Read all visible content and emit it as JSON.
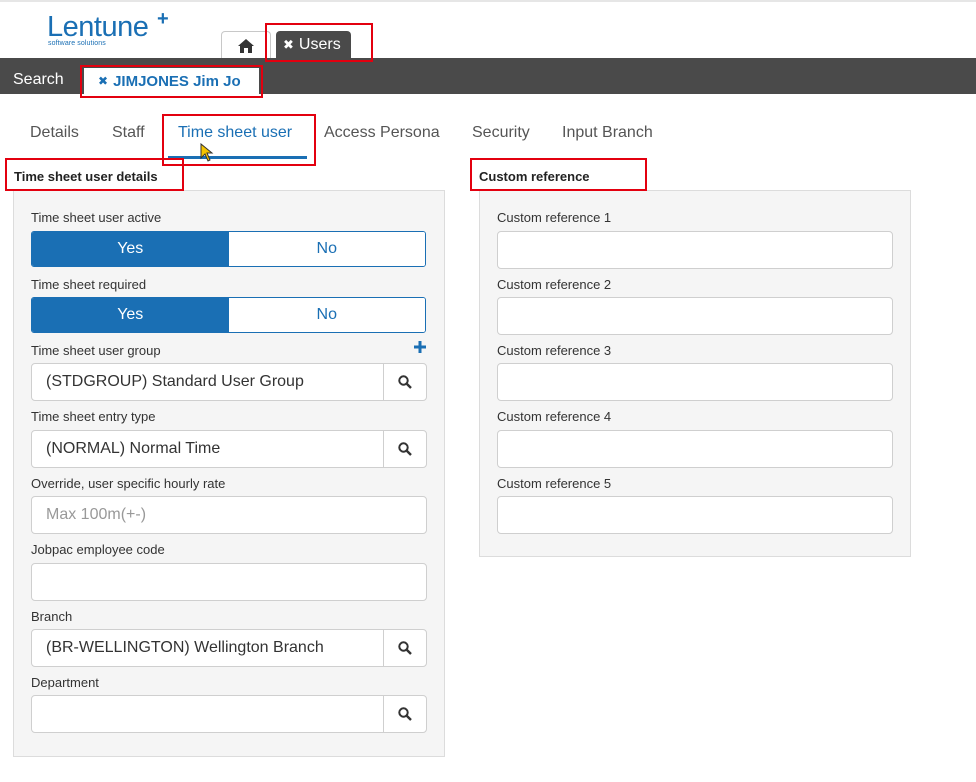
{
  "logo": {
    "name": "Lentune",
    "plus": "+",
    "tagline": "software solutions"
  },
  "top_tabs": {
    "home_icon": "home-icon",
    "users_label": "Users",
    "close_glyph": "✖"
  },
  "nav": {
    "search_label": "Search",
    "record_label": "JIMJONES Jim Jo",
    "close_glyph": "✖"
  },
  "sub_tabs": [
    {
      "label": "Details"
    },
    {
      "label": "Staff"
    },
    {
      "label": "Time sheet user",
      "active": true
    },
    {
      "label": "Access Persona"
    },
    {
      "label": "Security"
    },
    {
      "label": "Input Branch"
    }
  ],
  "left_panel": {
    "title": "Time sheet user details",
    "active": {
      "label": "Time sheet user active",
      "yes": "Yes",
      "no": "No",
      "selected": "Yes"
    },
    "required": {
      "label": "Time sheet required",
      "yes": "Yes",
      "no": "No",
      "selected": "Yes"
    },
    "user_group": {
      "label": "Time sheet user group",
      "value": "(STDGROUP) Standard User Group"
    },
    "entry_type": {
      "label": "Time sheet entry type",
      "value": "(NORMAL) Normal Time"
    },
    "hourly_rate": {
      "label": "Override, user specific hourly rate",
      "value": "",
      "placeholder": "Max 100m(+-)"
    },
    "employee_code": {
      "label": "Jobpac employee code",
      "value": ""
    },
    "branch": {
      "label": "Branch",
      "value": "(BR-WELLINGTON) Wellington Branch"
    },
    "department": {
      "label": "Department",
      "value": ""
    }
  },
  "right_panel": {
    "title": "Custom reference",
    "fields": [
      {
        "label": "Custom reference 1",
        "value": ""
      },
      {
        "label": "Custom reference 2",
        "value": ""
      },
      {
        "label": "Custom reference 3",
        "value": ""
      },
      {
        "label": "Custom reference 4",
        "value": ""
      },
      {
        "label": "Custom reference 5",
        "value": ""
      }
    ]
  },
  "colors": {
    "accent": "#1a6fb4",
    "bar": "#4a4a4a",
    "annotation": "#e3000f"
  }
}
